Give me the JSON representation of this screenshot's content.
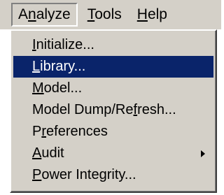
{
  "menubar": {
    "items": [
      {
        "label": "Analyze",
        "mnemonic_index": 1
      },
      {
        "label": "Tools",
        "mnemonic_index": 0
      },
      {
        "label": "Help",
        "mnemonic_index": 0
      }
    ]
  },
  "analyze_menu": {
    "items": [
      {
        "label": "Initialize...",
        "mnemonic_index": 0,
        "selected": false
      },
      {
        "label": "Library...",
        "mnemonic_index": 0,
        "selected": true
      },
      {
        "label": "Model...",
        "mnemonic_index": 0,
        "selected": false
      },
      {
        "label": "Model Dump/Refresh...",
        "mnemonic_index": 13,
        "selected": false
      },
      {
        "label": "Preferences",
        "mnemonic_index": 1,
        "selected": false
      },
      {
        "label": "Audit",
        "mnemonic_index": 0,
        "selected": false,
        "has_submenu": true
      },
      {
        "label": "Power Integrity...",
        "mnemonic_index": 0,
        "selected": false
      }
    ]
  },
  "colors": {
    "menu_background": "#d4d0c8",
    "selection_background": "#0a246a",
    "selection_text": "#ffffff"
  }
}
